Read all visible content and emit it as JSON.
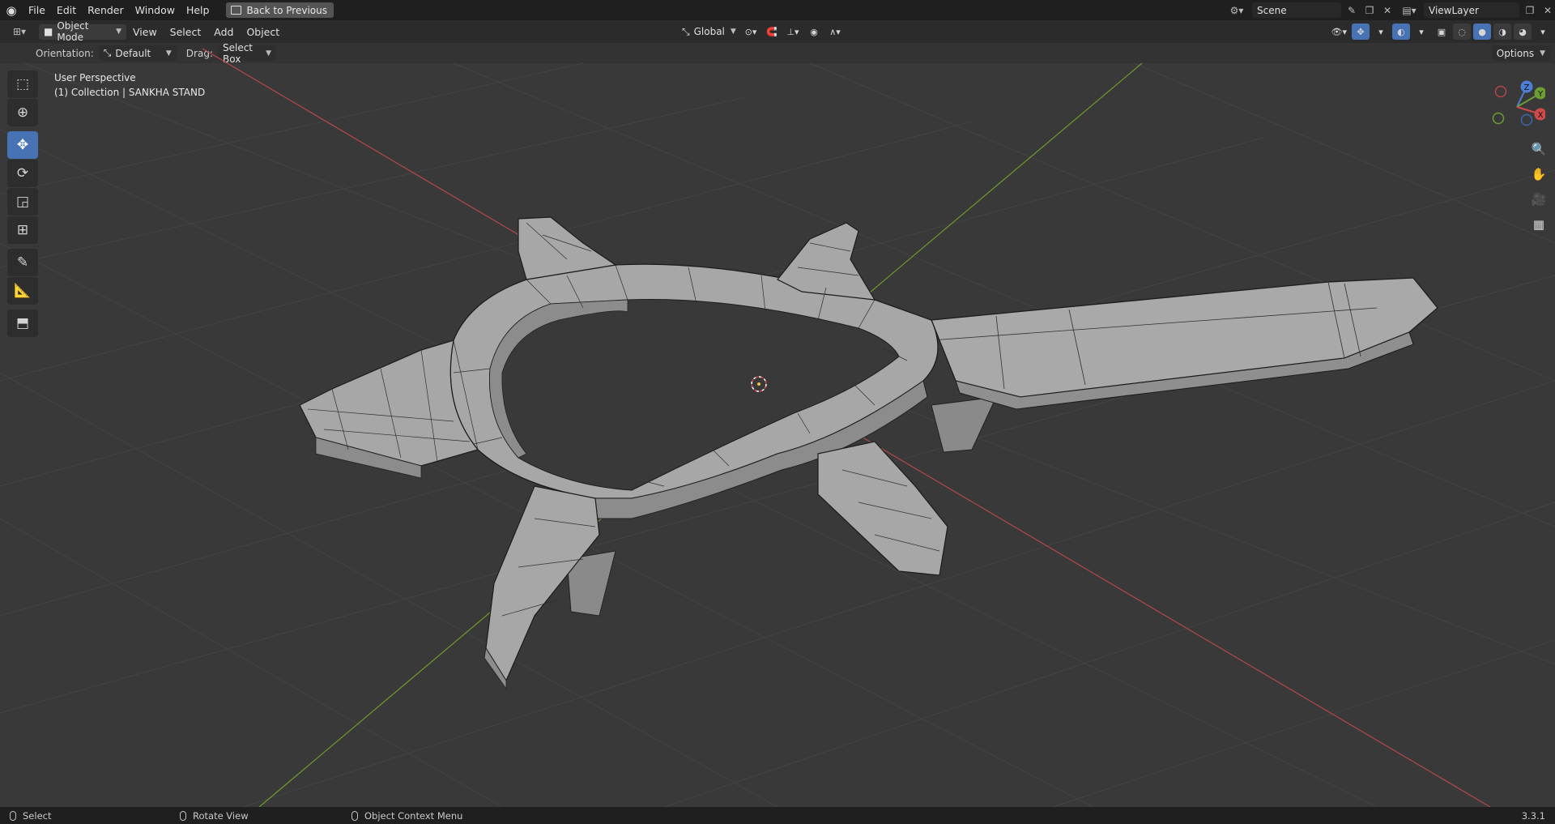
{
  "menu": {
    "file": "File",
    "edit": "Edit",
    "render": "Render",
    "window": "Window",
    "help": "Help"
  },
  "back_button": "Back to Previous",
  "scene": {
    "name": "Scene"
  },
  "view_layer": {
    "name": "ViewLayer"
  },
  "header": {
    "mode": "Object Mode",
    "view": "View",
    "select": "Select",
    "add": "Add",
    "object": "Object",
    "transform_orientation": "Global",
    "options": "Options"
  },
  "tool_settings": {
    "orientation_label": "Orientation:",
    "orientation_value": "Default",
    "drag_label": "Drag:",
    "drag_value": "Select Box"
  },
  "viewport": {
    "perspective": "User Perspective",
    "collection": "(1) Collection | SANKHA STAND"
  },
  "gizmo": {
    "z": "Z",
    "y": "Y",
    "x": "X"
  },
  "status": {
    "select": "Select",
    "rotate": "Rotate View",
    "context_menu": "Object Context Menu",
    "version": "3.3.1"
  },
  "colors": {
    "x_axis": "#b54848",
    "y_axis": "#6e9a2c",
    "active_tool": "#4772b3"
  }
}
